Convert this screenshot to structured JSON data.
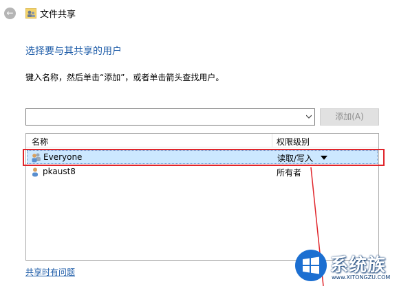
{
  "window": {
    "title": "文件共享",
    "back_icon": "back-arrow-icon",
    "app_icon": "share-users-icon"
  },
  "heading": "选择要与其共享的用户",
  "instruction": "键入名称，然后单击“添加”，或者单击箭头查找用户。",
  "combo": {
    "value": "",
    "arrow_icon": "chevron-down-icon"
  },
  "add_button": "添加(A)",
  "list": {
    "columns": [
      "名称",
      "权限级别"
    ],
    "rows": [
      {
        "name": "Everyone",
        "permission": "读取/写入",
        "icon": "user-group-icon",
        "selected": true
      },
      {
        "name": "pkaust8",
        "permission": "所有者",
        "icon": "user-icon",
        "selected": false
      }
    ]
  },
  "help_link": "共享时有问题",
  "watermark": {
    "text": "系统族",
    "domain": "www.XITONGZU.COM"
  },
  "colors": {
    "accent": "#1e5ca8",
    "selection": "#cce8ff",
    "annotation_red": "#e0242a"
  }
}
